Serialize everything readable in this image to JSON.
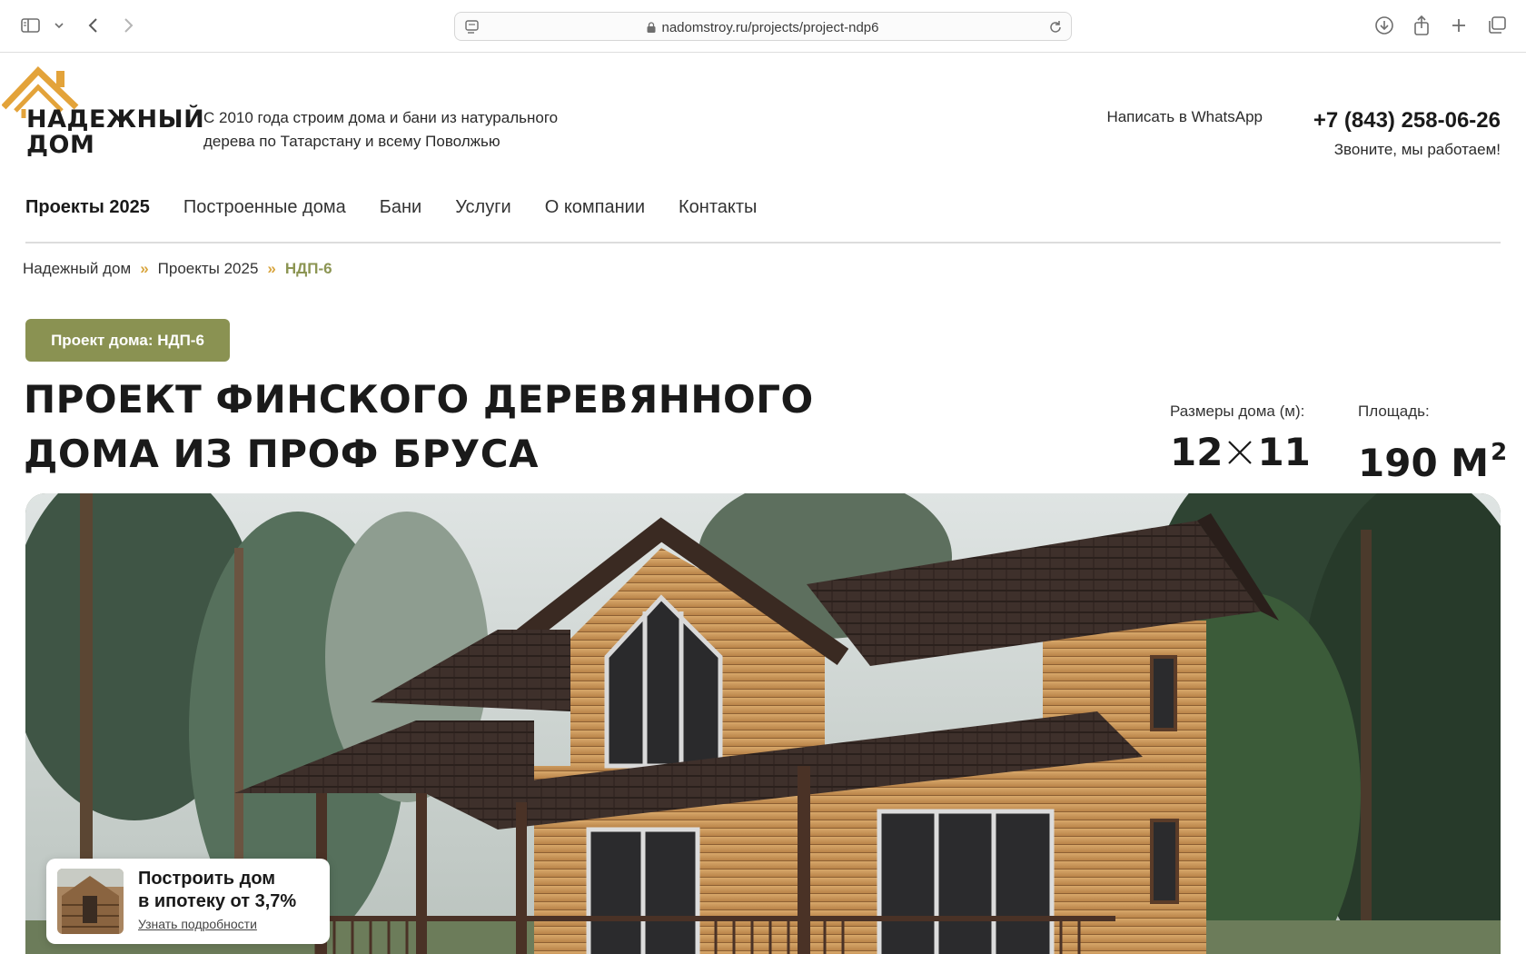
{
  "browser": {
    "url": "nadomstroy.ru/projects/project-ndp6",
    "icons": [
      "sidebar-icon",
      "chevron-down-icon",
      "back-icon",
      "forward-icon",
      "reader-icon",
      "lock-icon",
      "reload-icon",
      "download-icon",
      "share-icon",
      "new-tab-icon",
      "tabs-overview-icon"
    ]
  },
  "header": {
    "logo_line1": "НАДЕЖНЫЙ",
    "logo_line2": "ДОМ",
    "tagline_line1": "С 2010 года строим дома и бани из натурального",
    "tagline_line2": "дерева по Татарстану и всему Поволжью",
    "whatsapp": "Написать в WhatsApp",
    "phone": "+7 (843) 258-06-26",
    "phone_note": "Звоните, мы работаем!"
  },
  "nav": {
    "items": [
      {
        "label": "Проекты 2025"
      },
      {
        "label": "Построенные дома"
      },
      {
        "label": "Бани"
      },
      {
        "label": "Услуги"
      },
      {
        "label": "О компании"
      },
      {
        "label": "Контакты"
      }
    ]
  },
  "breadcrumb": {
    "items": [
      "Надежный дом",
      "Проекты 2025",
      "НДП-6"
    ],
    "separator": "»"
  },
  "project": {
    "badge": "Проект дома: НДП-6",
    "title_line1": "Проект финского деревянного",
    "title_line2": "дома из проф бруса",
    "size_label": "Размеры дома (м):",
    "size_a": "12",
    "size_b": "11",
    "area_label": "Площадь:",
    "area_value": "190 м",
    "area_unit_sup": "2"
  },
  "promo": {
    "title_line1": "Построить дом",
    "title_line2": "в ипотеку от 3,7%",
    "link": "Узнать подробности"
  },
  "colors": {
    "accent_green": "#8a9252",
    "breadcrumb_current": "#8c9553",
    "breadcrumb_separator": "#d9a640",
    "logo_roof": "#e3a33a"
  }
}
